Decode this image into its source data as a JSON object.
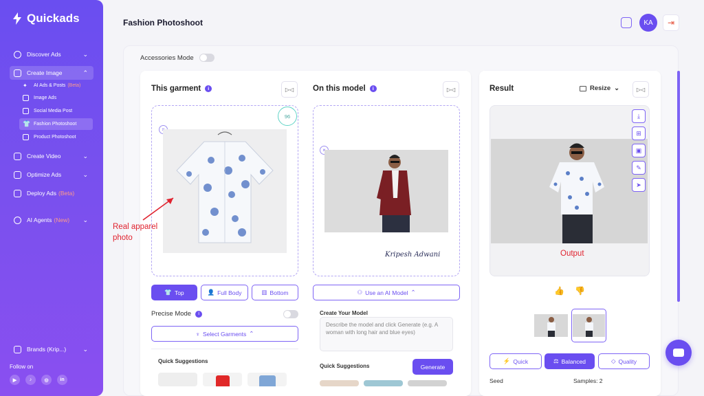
{
  "brand": {
    "name": "Quickads"
  },
  "sidebar": {
    "items": [
      {
        "label": "Discover Ads",
        "chevron": "⌄"
      },
      {
        "label": "Create Image",
        "chevron": "⌃"
      },
      {
        "label": "Create Video",
        "chevron": "⌄"
      },
      {
        "label": "Optimize Ads",
        "chevron": "⌄"
      },
      {
        "label": "Deploy Ads",
        "tag": "(Beta)"
      },
      {
        "label": "AI Agents",
        "tag": "(New)",
        "chevron": "⌄"
      },
      {
        "label": "Brands (Krip...)",
        "chevron": "⌄"
      }
    ],
    "sub_items": [
      {
        "label": "AI Ads & Posts",
        "tag": "(Beta)"
      },
      {
        "label": "Image Ads"
      },
      {
        "label": "Social Media Post"
      },
      {
        "label": "Fashion Photoshoot"
      },
      {
        "label": "Product Photoshoot"
      }
    ],
    "follow_label": "Follow on",
    "socials": [
      "▶",
      "♪",
      "◎",
      "in"
    ]
  },
  "header": {
    "title": "Fashion Photoshoot",
    "avatar_initials": "KA"
  },
  "accessories_mode_label": "Accessories Mode",
  "garment": {
    "title": "This garment",
    "score": "96",
    "buttons": {
      "top": "Top",
      "full_body": "Full Body",
      "bottom": "Bottom"
    },
    "precise_mode": "Precise Mode",
    "select_garments": "Select Garments",
    "quick_suggestions": "Quick Suggestions"
  },
  "model": {
    "title": "On this model",
    "signature": "Kripesh Adwani",
    "use_ai_model": "Use an AI Model",
    "create_your_model": "Create Your Model",
    "textarea_placeholder": "Describe the model and click Generate (e.g. A woman with long hair and blue eyes)",
    "quick_suggestions": "Quick Suggestions",
    "generate": "Generate"
  },
  "result": {
    "title": "Result",
    "resize": "Resize",
    "modes": {
      "quick": "Quick",
      "balanced": "Balanced",
      "quality": "Quality"
    },
    "seed_label": "Seed",
    "samples_label": "Samples: 2"
  },
  "annotations": {
    "real_photo": "Real apparel photo",
    "output": "Output"
  },
  "colors": {
    "accent": "#6a4ef0",
    "annotation": "#e0232f"
  }
}
